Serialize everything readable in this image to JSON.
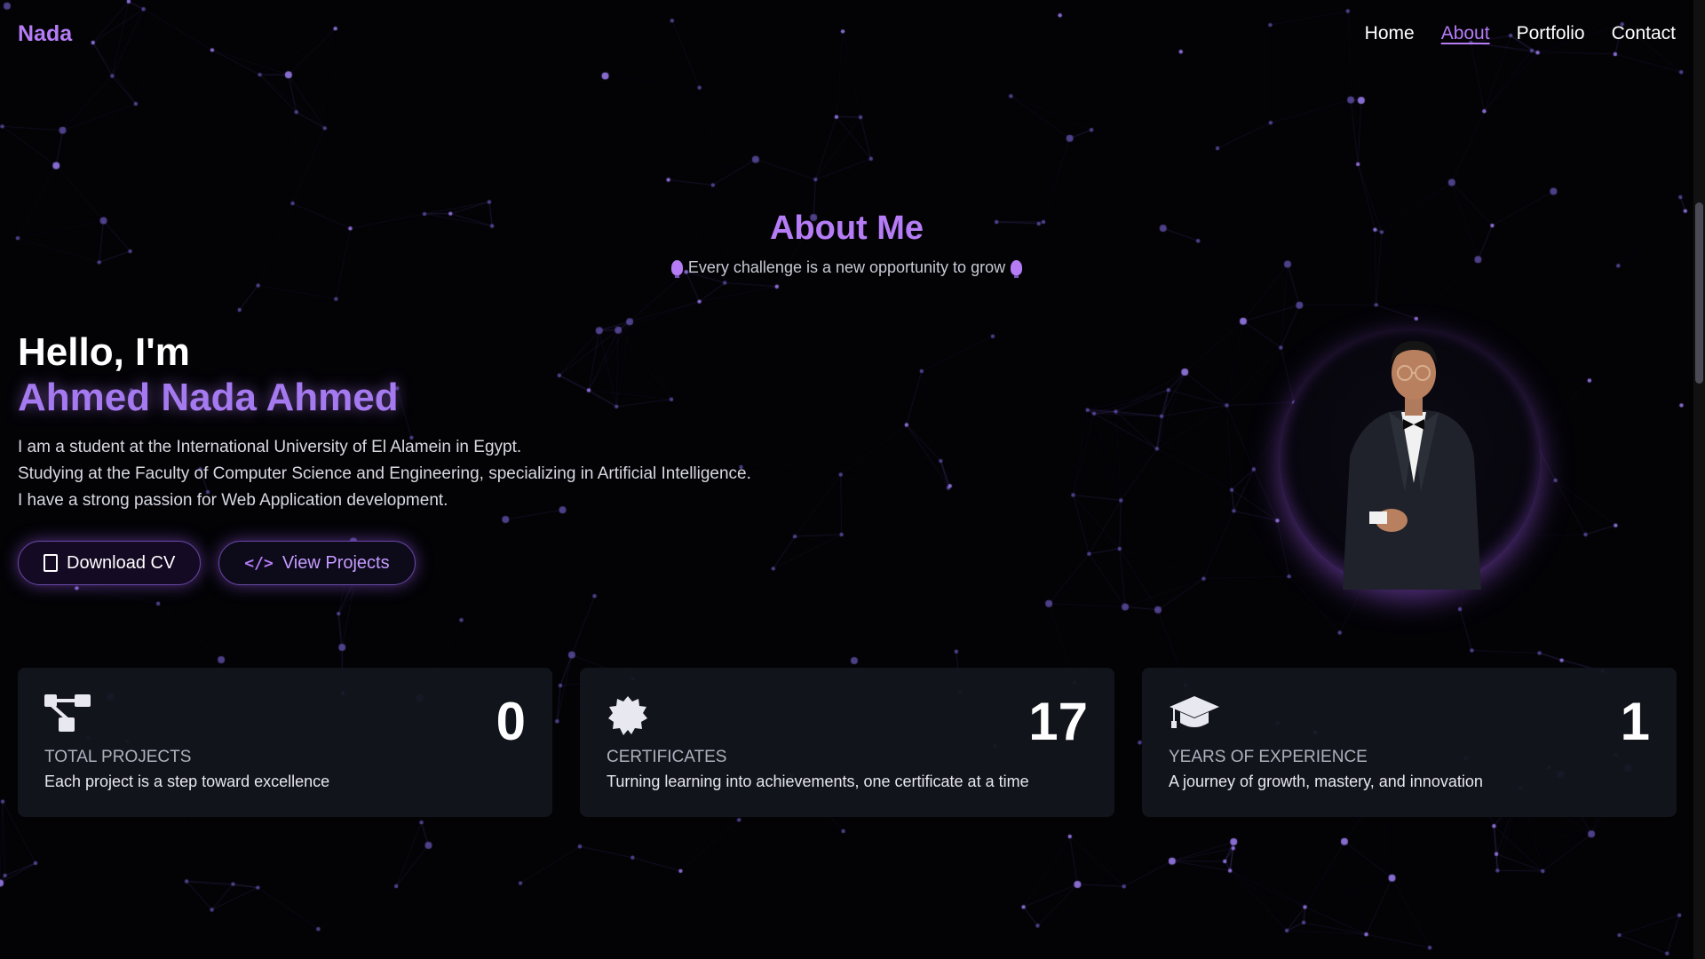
{
  "nav": {
    "brand": "Nada",
    "links": [
      "Home",
      "About",
      "Portfolio",
      "Contact"
    ],
    "active": "About"
  },
  "about": {
    "title": "About Me",
    "subtitle": "Every challenge is a new opportunity to grow",
    "bulb_icon": "lightbulb-icon"
  },
  "hero": {
    "greeting": "Hello, I'm",
    "name": "Ahmed Nada Ahmed",
    "bio": [
      "I am a student at the International University of El Alamein in Egypt.",
      "Studying at the Faculty of Computer Science and Engineering, specializing in Artificial Intelligence.",
      "I have a strong passion for Web Application development."
    ],
    "buttons": {
      "download_cv": "Download CV",
      "view_projects": "View Projects"
    }
  },
  "stats": [
    {
      "icon": "project-diagram-icon",
      "value": "0",
      "label": "TOTAL PROJECTS",
      "description": "Each project is a step toward excellence"
    },
    {
      "icon": "certificate-icon",
      "value": "17",
      "label": "CERTIFICATES",
      "description": "Turning learning into achievements, one certificate at a time"
    },
    {
      "icon": "graduation-cap-icon",
      "value": "1",
      "label": "YEARS OF EXPERIENCE",
      "description": "A journey of growth, mastery, and innovation"
    }
  ],
  "colors": {
    "accent": "#b57cf6",
    "background": "#030306",
    "card": "#13161e"
  }
}
